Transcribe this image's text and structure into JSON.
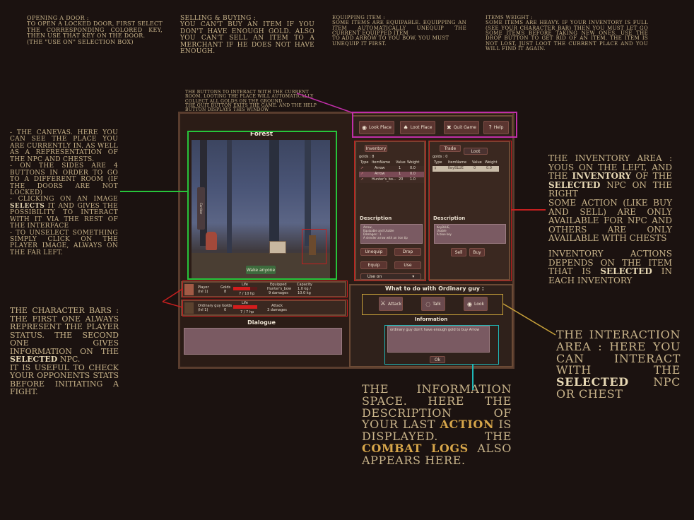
{
  "notes": {
    "door": {
      "title": "Opening a door :",
      "body": [
        "To open a locked door, first select the corresponding colored key, then use that key on the door.",
        "(the \"use on\" selection box)"
      ]
    },
    "selling": {
      "title": "Selling & Buying :",
      "body": [
        "You can't buy an item if you don't have enough gold. Also you can't sell an item to a merchant if he does not have enough."
      ]
    },
    "equipping": {
      "title": "Equipping item :",
      "body": [
        "Some items are equipable. Equipping an item automatically unequip the current equipped item",
        "To add arrow to you bow, you must unequip it first."
      ]
    },
    "weight": {
      "title": "Items weight :",
      "body": [
        "Some items are heavy. If your inventory is full (see your character bar) then you must let go some items before taking new ones. use the drop button to get rid of an item. The item is not lost, just loot the current place and you will find it again."
      ]
    },
    "buttons": [
      "The buttons to interact with the current room. Looting the place will automatically collect all golds on the ground.",
      "The quit button exits the game. And the help button displays this window"
    ],
    "canvas": [
      "- The canevas. Here you can see the place you are currently in. As well as a representation of the NPC and chests.",
      "- On the sides are 4 buttons in order to go to a different room (if the doors are not locked)",
      "- Clicking on an image",
      "selects",
      "it and gives the possibility to interact with it via the rest of the interface",
      "- To unselect something simply click on the player image, always on the far left."
    ],
    "bars": [
      "The character bars : the first one always represent the player status. The second one gives information on the",
      "selected",
      "NPC.",
      "It is useful to check your opponents stats before initiating a fight."
    ],
    "inventory": [
      "The inventory area : yous on the left, and the",
      "inventory",
      "of the",
      "selected",
      "NPC on the right",
      "Some action (like buy and sell) are only available for NPC and others are only available with chests",
      "Inventory actions depends on the item that is",
      "selected",
      "in each inventory"
    ],
    "interaction": [
      "The interaction area : here you can interact with the",
      "selected",
      "NPC or chest"
    ],
    "information": [
      "The information space. Here the description of your last",
      "action",
      "is displayed. The",
      "combat logs",
      "also appears here."
    ]
  },
  "game": {
    "place_title": "Forest",
    "side_label": "Corridor",
    "loot_label": "Wake anyone",
    "top_buttons": [
      "Look Place",
      "Loot Place",
      "Quit Game",
      "Help"
    ],
    "left_inv": {
      "tab": "Inventory",
      "gold": "golds : 8",
      "headers": [
        "Type",
        "ItemName",
        "Value",
        "Weight"
      ],
      "rows": [
        [
          "",
          "Arrow",
          "1",
          "0.0"
        ],
        [
          "",
          "Arrow",
          "1",
          "0.0"
        ],
        [
          "",
          "Hunter's_bo...",
          "20",
          "1.0"
        ]
      ],
      "desc_title": "Description",
      "desc": [
        "Arrow,",
        "Equipable and Usable",
        "Damages : 1",
        "A slender arrow with an iron tip"
      ],
      "buttons": [
        "Unequip",
        "Drop",
        "Equip",
        "Use"
      ],
      "use_on": "Use on"
    },
    "right_inv": {
      "tabs": [
        "Trade",
        "Loot"
      ],
      "gold": "golds : 0",
      "headers": [
        "Type",
        "ItemName",
        "Value",
        "Weight"
      ],
      "rows": [
        [
          "",
          "KeyBLUE",
          "0",
          "0.0"
        ]
      ],
      "desc_title": "Description",
      "desc": [
        "KeyBLUE,",
        "Usable",
        "A blue key"
      ],
      "buttons": [
        "Sell",
        "Buy"
      ]
    },
    "player_bar": {
      "name": "Player",
      "level": "(lvl 1)",
      "golds_label": "Golds",
      "golds": "8",
      "life_label": "Life",
      "life": "7 / 10 hp",
      "eq_label": "Equipped",
      "eq": "Hunter's_bow",
      "eq_dmg": "9 damages",
      "cap_label": "Capacity",
      "cap": "1.0 kg /",
      "cap_max": "10.0 kg"
    },
    "npc_bar": {
      "name": "Ordinary guy",
      "level": "(lvl 1)",
      "golds_label": "Golds",
      "golds": "0",
      "life_label": "Life",
      "life": "7 / 7 hp",
      "atk_label": "Attack",
      "atk": "3 damages"
    },
    "dialogue_title": "Dialogue",
    "what_to_do": "What to do with Ordinary guy :",
    "actions": [
      "Attack",
      "Talk",
      "Look"
    ],
    "info_title": "Information",
    "info_text": "ordinary guy don't have enough gold to buy Arrow",
    "ok": "Ok"
  },
  "colors": {
    "magenta": "#c02ea8",
    "green": "#27c43a",
    "red": "#c41f1f",
    "yellow": "#c9a23a",
    "cyan": "#1fb8b8"
  }
}
